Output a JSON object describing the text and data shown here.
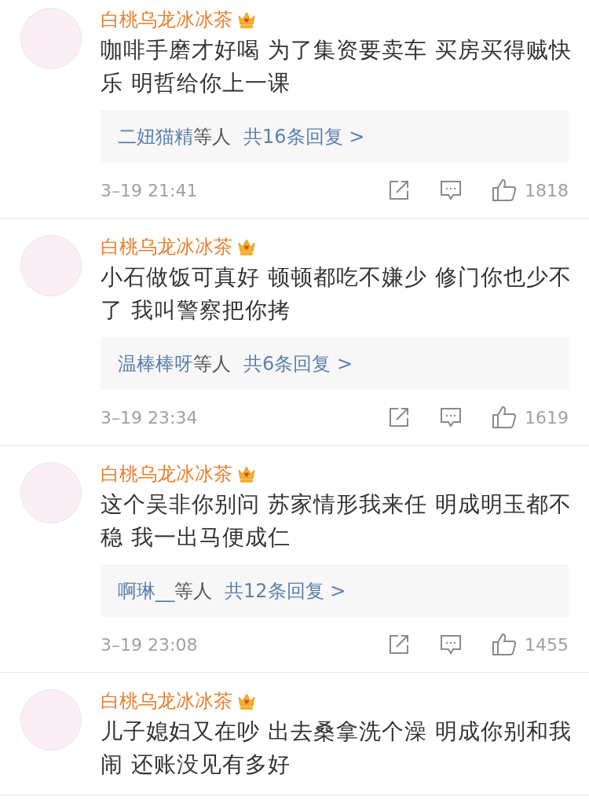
{
  "comments": [
    {
      "name": "白桃乌龙冰冰茶",
      "vip": true,
      "text": "咖啡手磨才好喝 为了集资要卖车 买房买得贼快乐 明哲给你上一课",
      "replies": {
        "who": "二妞猫精",
        "suffix": "等人",
        "count": "共16条回复 >"
      },
      "time": "3–19 21:41",
      "likes": "1818"
    },
    {
      "name": "白桃乌龙冰冰茶",
      "vip": true,
      "text": "小石做饭可真好 顿顿都吃不嫌少 修门你也少不了 我叫警察把你拷",
      "replies": {
        "who": "温棒棒呀",
        "suffix": "等人",
        "count": "共6条回复 >"
      },
      "time": "3–19 23:34",
      "likes": "1619"
    },
    {
      "name": "白桃乌龙冰冰茶",
      "vip": true,
      "text": "这个吴非你别问 苏家情形我来任 明成明玉都不稳 我一出马便成仁",
      "replies": {
        "who": "啊琳__",
        "suffix": "等人",
        "count": "共12条回复 >"
      },
      "time": "3–19 23:08",
      "likes": "1455"
    },
    {
      "name": "白桃乌龙冰冰茶",
      "vip": true,
      "text": "儿子媳妇又在吵 出去桑拿洗个澡 明成你别和我闹 还账没见有多好"
    }
  ]
}
